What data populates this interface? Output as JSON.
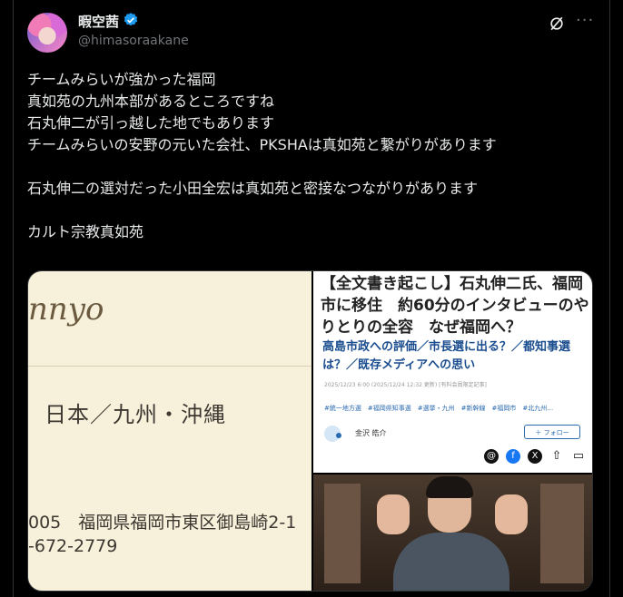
{
  "post": {
    "display_name": "暇空茜",
    "handle": "@himasoraakane",
    "more_label": "···",
    "text": "チームみらいが強かった福岡\n真如苑の九州本部があるところですね\n石丸伸二が引っ越した地でもあります\nチームみらいの安野の元いた会社、PKSHAは真如苑と繋がりがあります\n\n石丸伸二の選対だった小田全宏は真如苑と密接なつながりがあります\n\nカルト宗教真如苑"
  },
  "media": {
    "left": {
      "brand": "nnyo",
      "region": "日本／九州・沖縄",
      "address": "005　福岡県福岡市東区御島崎2-1",
      "phone": "-672-2779"
    },
    "right": {
      "headline": "【全文書き起こし】石丸伸二氏、福岡市に移住　約60分のインタビューのやりとりの全容　なぜ福岡へ？",
      "subheadline": "高島市政への評価／市長選に出る？／都知事選は？／既存メディアへの思い",
      "date": "2025/12/23 6:00 (2025/12/24 12:32 更新) [有料会員限定記事]",
      "tags": "#統一地方選　#福岡県知事選　#選挙・九州　#新幹線　#福岡市　#北九州…",
      "author": "金沢 皓介",
      "follow": "＋ フォロー"
    }
  },
  "colors": {
    "verified": "#1d9bf0",
    "background": "#000000",
    "text": "#e7e9ea",
    "muted": "#71767b"
  }
}
